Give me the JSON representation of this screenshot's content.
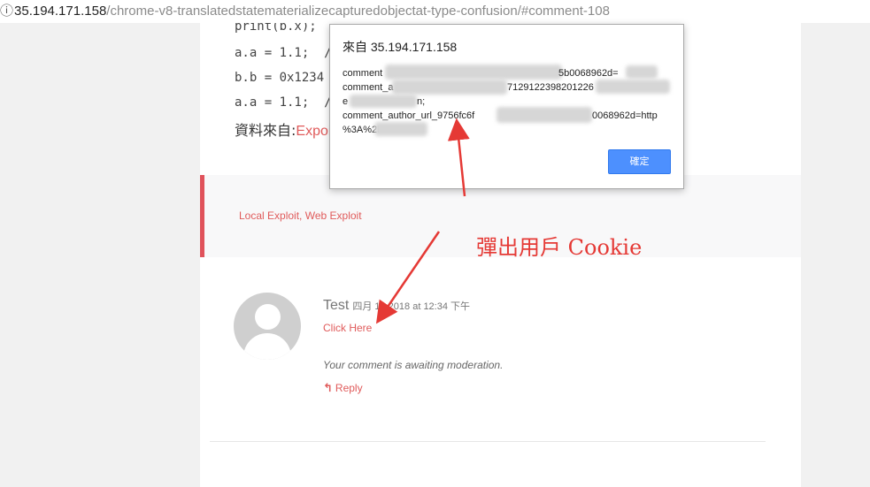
{
  "address_bar": {
    "host": "35.194.171.158",
    "path": "/chrome-v8-translatedstatematerializecapturedobjectat-type-confusion/#comment-108"
  },
  "article": {
    "code_lines": [
      "print(b.x);",
      "a.a = 1.1;  /",
      "b.b = 0x1234",
      "a.a = 1.1;  /"
    ],
    "source_label": "資料來自:",
    "source_link": "Expoit"
  },
  "categories": {
    "cat1": "Local Exploit",
    "separator": ", ",
    "cat2": "Web Exploit"
  },
  "comment": {
    "author": "Test",
    "date": "四月 1 , 2018 at 12:34 下午",
    "link_text": "Click Here",
    "moderation_note": "Your comment is awaiting moderation.",
    "reply_label": "Reply"
  },
  "dialog": {
    "title": "來自 35.194.171.158",
    "lines": [
      "comment",
      "comment_a",
      "e",
      "comment_author_url_9756fc6f"
    ],
    "line_fragments": [
      "5b0068962d=",
      "7129122398201226",
      "n;",
      "0068962d=http"
    ],
    "line5": "%3A%2F",
    "ok_label": "確定"
  },
  "annotation": {
    "text": "彈出用戶 Cookie",
    "color": "#e53935"
  }
}
